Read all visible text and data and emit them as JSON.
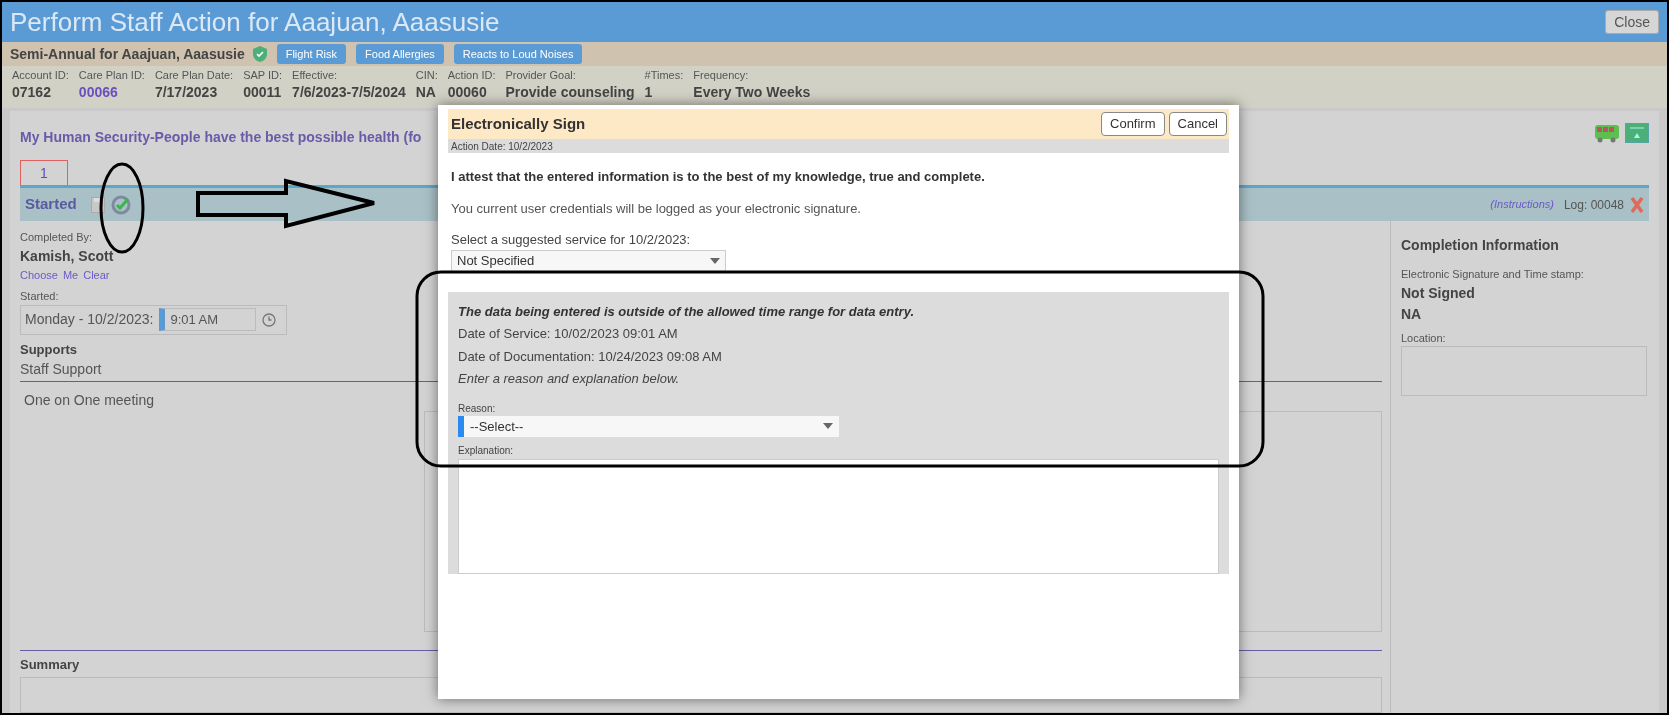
{
  "window": {
    "title": "Perform Staff Action for Aaajuan, Aaasusie",
    "close": "Close"
  },
  "plan": {
    "title": "Semi-Annual for Aaajuan, Aaasusie",
    "alerts": [
      "Flight Risk",
      "Food Allergies",
      "Reacts to Loud Noises"
    ]
  },
  "info": [
    {
      "label": "Account ID:",
      "value": "07162",
      "kind": "text"
    },
    {
      "label": "Care Plan ID:",
      "value": "00066",
      "kind": "link"
    },
    {
      "label": "Care Plan Date:",
      "value": "7/17/2023",
      "kind": "text"
    },
    {
      "label": "SAP ID:",
      "value": "00011",
      "kind": "text"
    },
    {
      "label": "Effective:",
      "value": "7/6/2023-7/5/2024",
      "kind": "text"
    },
    {
      "label": "CIN:",
      "value": "NA",
      "kind": "text"
    },
    {
      "label": "Action ID:",
      "value": "00060",
      "kind": "text"
    },
    {
      "label": "Provider Goal:",
      "value": "Provide counseling",
      "kind": "text"
    },
    {
      "label": "#Times:",
      "value": "1",
      "kind": "text"
    },
    {
      "label": "Frequency:",
      "value": "Every Two Weeks",
      "kind": "text"
    }
  ],
  "goal": {
    "title": "My Human Security-People have the best possible health (fo"
  },
  "tabs": [
    {
      "label": "1",
      "selected": true
    }
  ],
  "status": {
    "label": "Started",
    "instructions": "(Instructions)",
    "log": "Log: 00048"
  },
  "completed_by": {
    "label": "Completed By:",
    "name": "Kamish, Scott",
    "links": [
      "Choose",
      "Me",
      "Clear"
    ]
  },
  "started": {
    "label": "Started:",
    "date": "Monday - 10/2/2023:",
    "time": "9:01 AM"
  },
  "supports": {
    "title": "Supports",
    "subtitle": "Staff Support",
    "text": "One on One meeting"
  },
  "summary": {
    "title": "Summary"
  },
  "completion": {
    "title": "Completion Information",
    "signature_label": "Electronic Signature and Time stamp:",
    "signature": "Not Signed",
    "signature_time": "NA",
    "location_label": "Location:"
  },
  "dialog": {
    "title": "Electronically Sign",
    "buttons": [
      "Confirm",
      "Cancel"
    ],
    "action_date": "Action Date: 10/2/2023",
    "attest": "I attest that the entered information is to the best of my knowledge, true and complete.",
    "credentials": "You current user credentials will be logged as your electronic signature.",
    "service_label": "Select a suggested service for 10/2/2023:",
    "service_value": "Not Specified",
    "warning": {
      "heading": "The data being entered is outside of the allowed time range for data entry.",
      "lines": [
        "Date of Service: 10/02/2023 09:01 AM",
        "Date of Documentation: 10/24/2023 09:08 AM"
      ],
      "instruction": "Enter a reason and explanation below.",
      "reason_label": "Reason:",
      "reason_value": "--Select--",
      "explanation_label": "Explanation:"
    }
  }
}
